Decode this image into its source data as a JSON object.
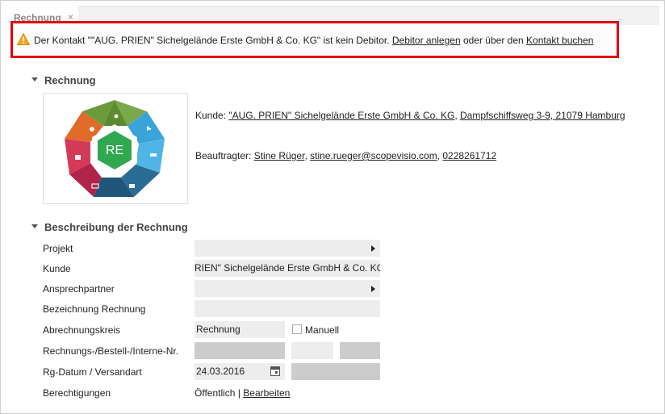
{
  "tab": {
    "title": "Rechnung",
    "close": "×"
  },
  "warning": {
    "text_before": "Der Kontakt \"\"AUG. PRIEN\" Sichelgelände Erste GmbH & Co. KG\" ist kein Debitor. ",
    "link1": "Debitor anlegen",
    "text_mid": " oder über den ",
    "link2": "Kontakt buchen",
    "highlight_color": "#e2000f"
  },
  "section_rechnung": {
    "title": "Rechnung"
  },
  "logo": {
    "label": "RE",
    "icon": "hexagon-app-logo"
  },
  "customer": {
    "label": "Kunde: ",
    "name": "\"AUG. PRIEN\" Sichelgelände Erste GmbH & Co. KG",
    "sep": ", ",
    "address": "Dampfschiffsweg 3-9, 21079 Hamburg"
  },
  "agent": {
    "label": "Beauftragter: ",
    "name": "Stine Rüger",
    "sep1": ", ",
    "email": "stine.rueger@scopevisio.com",
    "sep2": ", ",
    "phone": "0228261712"
  },
  "section_beschreibung": {
    "title": "Beschreibung der Rechnung"
  },
  "form": {
    "projekt": {
      "label": "Projekt",
      "value": ""
    },
    "kunde": {
      "label": "Kunde",
      "value": "RIEN\" Sichelgelände Erste GmbH & Co. KG"
    },
    "ansprechpartner": {
      "label": "Ansprechpartner",
      "value": ""
    },
    "bezeichnung": {
      "label": "Bezeichnung Rechnung",
      "value": ""
    },
    "abrechnungskreis": {
      "label": "Abrechnungskreis",
      "value": "Rechnung",
      "checkbox_label": "Manuell"
    },
    "nummern": {
      "label": "Rechnungs-/Bestell-/Interne-Nr."
    },
    "datum": {
      "label": "Rg-Datum / Versandart",
      "value": "24.03.2016"
    },
    "berechtigungen": {
      "label": "Berechtigungen",
      "value": "Öffentlich",
      "sep": " | ",
      "link": "Bearbeiten"
    }
  }
}
